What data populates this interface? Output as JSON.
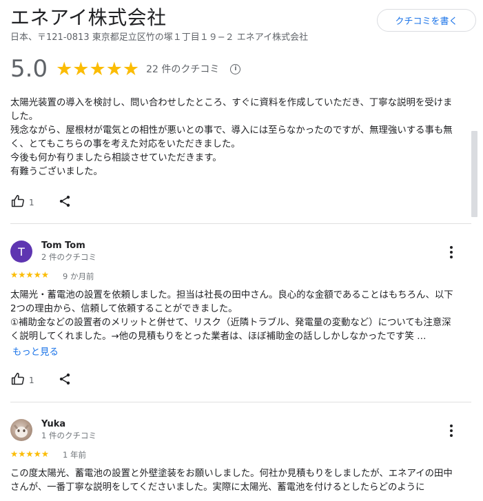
{
  "business": {
    "name": "エネアイ株式会社",
    "address": "日本、〒121-0813 東京都足立区竹の塚１丁目１９−２ エネアイ株式会社",
    "write_review_label": "クチコミを書く"
  },
  "summary": {
    "rating": "5.0",
    "stars": "★★★★★",
    "review_count": "22 件のクチコミ",
    "info_icon": "info-icon"
  },
  "reviews": [
    {
      "paragraphs": [
        "太陽光装置の導入を検討し、問い合わせしたところ、すぐに資料を作成していただき、丁寧な説明を受けました。",
        "残念ながら、屋根材が電気との相性が悪いとの事で、導入には至らなかったのですが、無理強いする事も無く、とてもこちらの事を考えた対応をいただきました。",
        "今後も何か有りましたら相談させていただきます。",
        "有難うございました。"
      ],
      "likes": "1"
    },
    {
      "avatar_letter": "T",
      "avatar_color": "#5e35b1",
      "author": "Tom Tom",
      "author_sub": "2 件のクチコミ",
      "stars": "★★★★★",
      "date": "9 か月前",
      "paragraphs": [
        "太陽光・蓄電池の設置を依頼しました。担当は社長の田中さん。良心的な金額であることはもちろん、以下2つの理由から、信頼して依頼することができました。",
        "①補助金などの設置者のメリットと併せて、リスク（近隣トラブル、発電量の変動など）についても注意深く説明してくれました。→他の見積もりをとった業者は、ほぼ補助金の話ししかしなかったです笑 …"
      ],
      "more_label": "もっと見る",
      "likes": "1"
    },
    {
      "author": "Yuka",
      "author_sub": "1 件のクチコミ",
      "stars": "★★★★★",
      "date": "1 年前",
      "paragraphs": [
        "この度太陽光、蓄電池の設置と外壁塗装をお願いしました。何社か見積もりをしましたが、エネアイの田中さんが、一番丁寧な説明をしてくださいました。実際に太陽光、蓄電池を付けるとしたらどのように"
      ]
    }
  ],
  "colors": {
    "star": "#fbbc04",
    "link": "#1a73e8",
    "muted": "#5f6368"
  }
}
